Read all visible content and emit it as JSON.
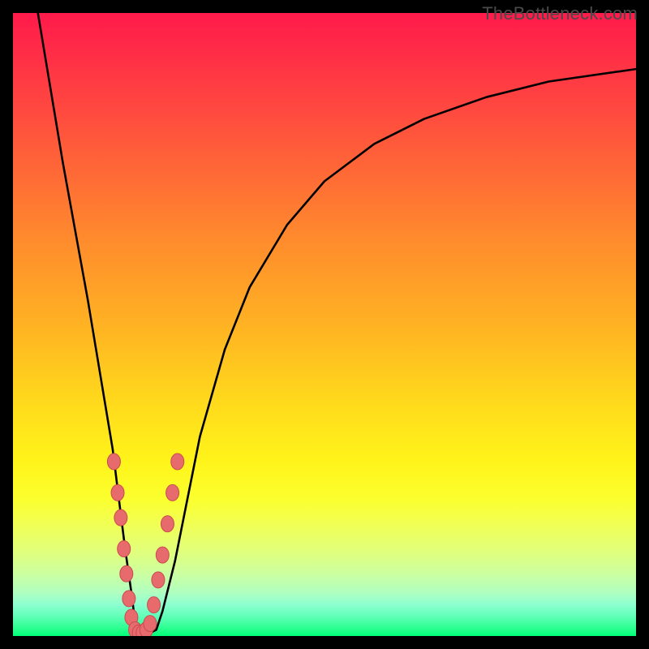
{
  "watermark": "TheBottleneck.com",
  "colors": {
    "frame": "#000000",
    "curveStroke": "#000000",
    "beadFill": "#e76a6d",
    "beadStroke": "#c94a4f"
  },
  "chart_data": {
    "type": "line",
    "title": "",
    "xlabel": "",
    "ylabel": "",
    "xlim": [
      0,
      100
    ],
    "ylim": [
      0,
      100
    ],
    "series": [
      {
        "name": "bottleneck-curve",
        "x": [
          4,
          6,
          8,
          10,
          12,
          14,
          16,
          17,
          18,
          19,
          19.5,
          20,
          21,
          22,
          23,
          24,
          26,
          28,
          30,
          34,
          38,
          44,
          50,
          58,
          66,
          76,
          86,
          100
        ],
        "y": [
          100,
          88,
          76,
          65,
          54,
          42,
          30,
          22,
          14,
          7,
          3,
          1,
          0.5,
          0.5,
          1,
          4,
          12,
          22,
          32,
          46,
          56,
          66,
          73,
          79,
          83,
          86.5,
          89,
          91
        ]
      }
    ],
    "beads": {
      "comment": "approximate marker positions along curve near minimum",
      "points": [
        {
          "x": 16.2,
          "y": 28
        },
        {
          "x": 16.8,
          "y": 23
        },
        {
          "x": 17.3,
          "y": 19
        },
        {
          "x": 17.8,
          "y": 14
        },
        {
          "x": 18.2,
          "y": 10
        },
        {
          "x": 18.6,
          "y": 6
        },
        {
          "x": 19.0,
          "y": 3
        },
        {
          "x": 19.6,
          "y": 1
        },
        {
          "x": 20.2,
          "y": 0.5
        },
        {
          "x": 20.8,
          "y": 0.5
        },
        {
          "x": 21.4,
          "y": 1
        },
        {
          "x": 22.0,
          "y": 2
        },
        {
          "x": 22.6,
          "y": 5
        },
        {
          "x": 23.3,
          "y": 9
        },
        {
          "x": 24.0,
          "y": 13
        },
        {
          "x": 24.8,
          "y": 18
        },
        {
          "x": 25.6,
          "y": 23
        },
        {
          "x": 26.4,
          "y": 28
        }
      ]
    }
  }
}
